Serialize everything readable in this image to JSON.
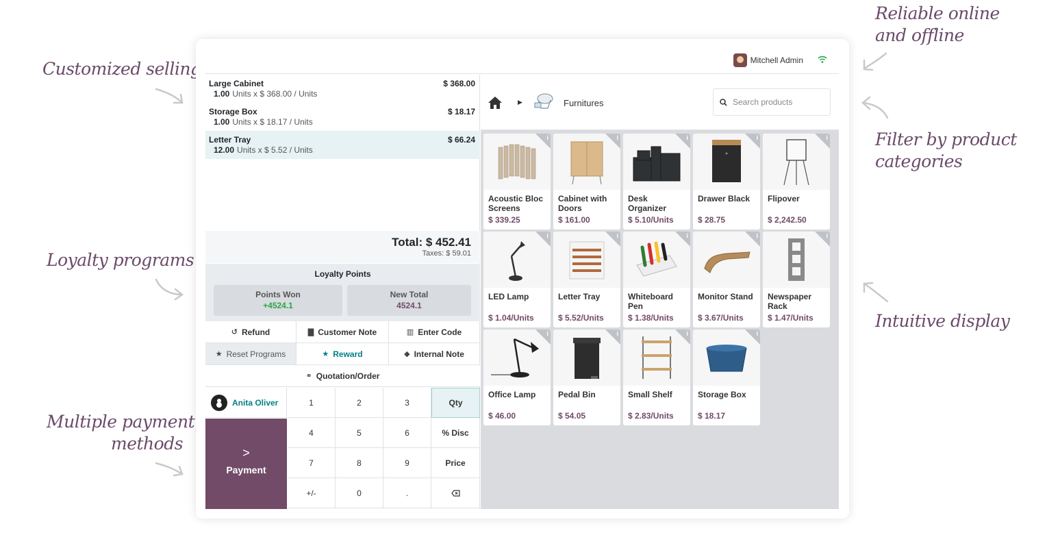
{
  "annotations": {
    "customized": "Customized selling",
    "loyalty": "Loyalty programs",
    "payment_l1": "Multiple payment",
    "payment_l2": "methods",
    "reliable_l1": "Reliable online",
    "reliable_l2": "and offline",
    "filter_l1": "Filter by product",
    "filter_l2": "categories",
    "intuitive": "Intuitive display"
  },
  "header": {
    "user_name": "Mitchell Admin"
  },
  "order": {
    "lines": [
      {
        "name": "Large Cabinet",
        "price": "$ 368.00",
        "qty": "1.00",
        "detail": "Units x $ 368.00 / Units"
      },
      {
        "name": "Storage Box",
        "price": "$ 18.17",
        "qty": "1.00",
        "detail": "Units x $ 18.17 / Units"
      },
      {
        "name": "Letter Tray",
        "price": "$ 66.24",
        "qty": "12.00",
        "detail": "Units x $ 5.52 / Units"
      }
    ],
    "total": "Total: $ 452.41",
    "taxes": "Taxes: $ 59.01"
  },
  "loyalty": {
    "title": "Loyalty Points",
    "won_label": "Points Won",
    "won_value": "+4524.1",
    "total_label": "New Total",
    "total_value": "4524.1",
    "won_color": "#28a745",
    "total_color": "#714b67"
  },
  "controls": {
    "refund": "Refund",
    "customer_note": "Customer Note",
    "enter_code": "Enter Code",
    "reset_programs": "Reset Programs",
    "reward": "Reward",
    "internal_note": "Internal Note",
    "quotation": "Quotation/Order"
  },
  "customer": "Anita Oliver",
  "payment_label": "Payment",
  "numpad": {
    "k1": "1",
    "k2": "2",
    "k3": "3",
    "qty": "Qty",
    "k4": "4",
    "k5": "5",
    "k6": "6",
    "disc": "% Disc",
    "k7": "7",
    "k8": "8",
    "k9": "9",
    "price": "Price",
    "plusminus": "+/-",
    "k0": "0",
    "dot": "."
  },
  "catalog": {
    "category": "Furnitures",
    "search_placeholder": "Search products",
    "products": [
      {
        "name": "Acoustic Bloc Screens",
        "price": "$ 339.25"
      },
      {
        "name": "Cabinet with Doors",
        "price": "$ 161.00"
      },
      {
        "name": "Desk Organizer",
        "price": "$ 5.10/Units"
      },
      {
        "name": "Drawer Black",
        "price": "$ 28.75"
      },
      {
        "name": "Flipover",
        "price": "$ 2,242.50"
      },
      {
        "name": "LED Lamp",
        "price": "$ 1.04/Units"
      },
      {
        "name": "Letter Tray",
        "price": "$ 5.52/Units"
      },
      {
        "name": "Whiteboard Pen",
        "price": "$ 1.38/Units"
      },
      {
        "name": "Monitor Stand",
        "price": "$ 3.67/Units"
      },
      {
        "name": "Newspaper Rack",
        "price": "$ 1.47/Units"
      },
      {
        "name": "Office Lamp",
        "price": "$ 46.00"
      },
      {
        "name": "Pedal Bin",
        "price": "$ 54.05"
      },
      {
        "name": "Small Shelf",
        "price": "$ 2.83/Units"
      },
      {
        "name": "Storage Box",
        "price": "$ 18.17"
      }
    ]
  },
  "colors": {
    "brand": "#714b67",
    "accent": "#017e84"
  }
}
